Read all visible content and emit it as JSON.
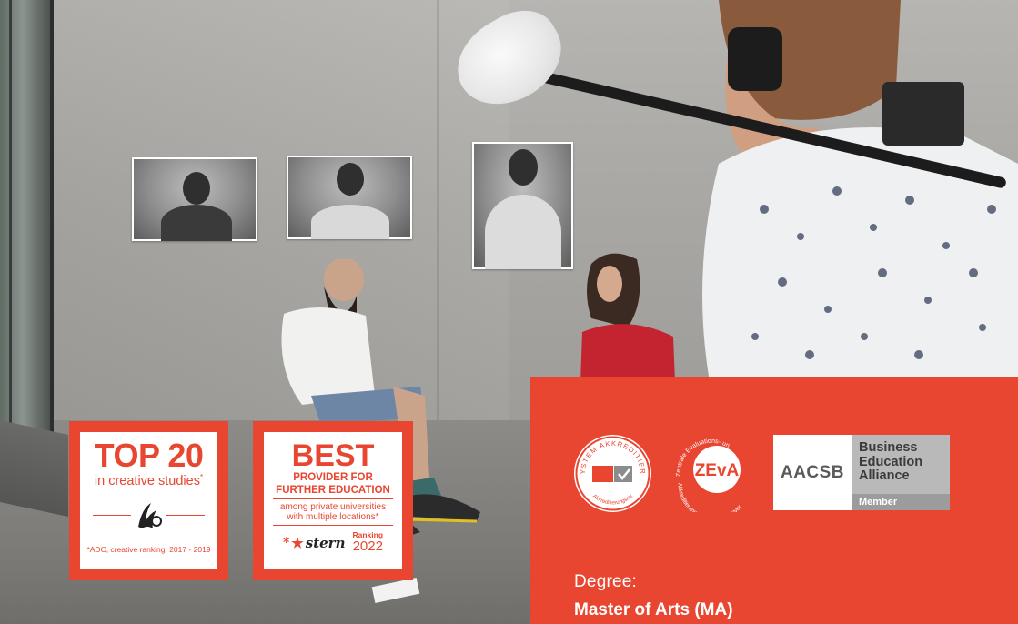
{
  "badges": {
    "top20": {
      "title": "TOP 20",
      "subtitle": "in creative studies",
      "asterisk": "*",
      "footnote": "*ADC, creative ranking, 2017 - 2019",
      "logo_icon": "adc-logo"
    },
    "best": {
      "title": "BEST",
      "subtitle_line1": "PROVIDER FOR",
      "subtitle_line2": "FURTHER EDUCATION",
      "note_line1": "among private universities",
      "note_line2": "with multiple locations*",
      "brand": "stern",
      "brand_star": "*",
      "ranking_label": "Ranking",
      "ranking_year": "2022"
    }
  },
  "accreditation": {
    "system_seal": {
      "ring_top": "SYSTEM AKKREDITIERT",
      "ring_bottom": "Akkreditierungsrat"
    },
    "zeva_seal": {
      "mark": "ZEvA",
      "ring_top": "Zentrale Evaluations- und",
      "ring_bottom": "Akkreditierungsagentur Hannover"
    },
    "aacsb": {
      "logo": "AACSB",
      "line1": "Business",
      "line2": "Education",
      "line3": "Alliance",
      "member": "Member"
    }
  },
  "degree": {
    "label": "Degree:",
    "value": "Master of Arts (MA)"
  },
  "colors": {
    "brand_red": "#e84631",
    "white": "#ffffff"
  }
}
